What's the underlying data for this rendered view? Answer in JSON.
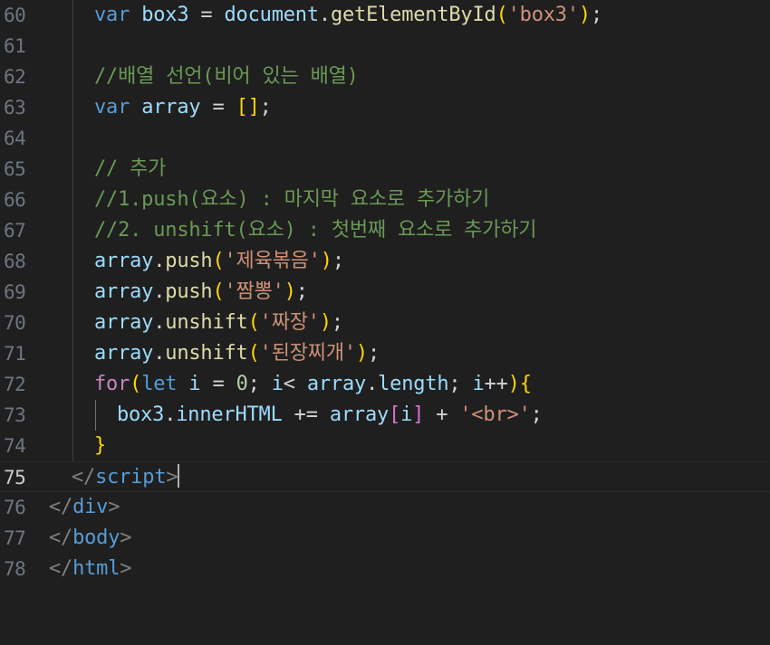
{
  "editor": {
    "current_line": "75",
    "lines": [
      {
        "number": "60",
        "indent": 2,
        "tokens": [
          {
            "t": "var",
            "c": "keyword"
          },
          {
            "t": " ",
            "c": "op"
          },
          {
            "t": "box3",
            "c": "var"
          },
          {
            "t": " = ",
            "c": "op"
          },
          {
            "t": "document",
            "c": "var"
          },
          {
            "t": ".",
            "c": "punct"
          },
          {
            "t": "getElementById",
            "c": "func"
          },
          {
            "t": "(",
            "c": "b1"
          },
          {
            "t": "'box3'",
            "c": "string"
          },
          {
            "t": ")",
            "c": "b1"
          },
          {
            "t": ";",
            "c": "punct"
          }
        ]
      },
      {
        "number": "61",
        "indent": 2,
        "tokens": []
      },
      {
        "number": "62",
        "indent": 2,
        "tokens": [
          {
            "t": "//배열 선언(비어 있는 배열)",
            "c": "comment"
          }
        ]
      },
      {
        "number": "63",
        "indent": 2,
        "tokens": [
          {
            "t": "var",
            "c": "keyword"
          },
          {
            "t": " ",
            "c": "op"
          },
          {
            "t": "array",
            "c": "var"
          },
          {
            "t": " = ",
            "c": "op"
          },
          {
            "t": "[]",
            "c": "b1"
          },
          {
            "t": ";",
            "c": "punct"
          }
        ]
      },
      {
        "number": "64",
        "indent": 2,
        "tokens": []
      },
      {
        "number": "65",
        "indent": 2,
        "tokens": [
          {
            "t": "// 추가",
            "c": "comment"
          }
        ]
      },
      {
        "number": "66",
        "indent": 2,
        "tokens": [
          {
            "t": "//1.push(요소) : 마지막 요소로 추가하기",
            "c": "comment"
          }
        ]
      },
      {
        "number": "67",
        "indent": 2,
        "tokens": [
          {
            "t": "//2. unshift(요소) : 첫번째 요소로 추가하기",
            "c": "comment"
          }
        ]
      },
      {
        "number": "68",
        "indent": 2,
        "tokens": [
          {
            "t": "array",
            "c": "var"
          },
          {
            "t": ".",
            "c": "punct"
          },
          {
            "t": "push",
            "c": "func"
          },
          {
            "t": "(",
            "c": "b1"
          },
          {
            "t": "'제육볶음'",
            "c": "string"
          },
          {
            "t": ")",
            "c": "b1"
          },
          {
            "t": ";",
            "c": "punct"
          }
        ]
      },
      {
        "number": "69",
        "indent": 2,
        "tokens": [
          {
            "t": "array",
            "c": "var"
          },
          {
            "t": ".",
            "c": "punct"
          },
          {
            "t": "push",
            "c": "func"
          },
          {
            "t": "(",
            "c": "b1"
          },
          {
            "t": "'짬뽕'",
            "c": "string"
          },
          {
            "t": ")",
            "c": "b1"
          },
          {
            "t": ";",
            "c": "punct"
          }
        ]
      },
      {
        "number": "70",
        "indent": 2,
        "tokens": [
          {
            "t": "array",
            "c": "var"
          },
          {
            "t": ".",
            "c": "punct"
          },
          {
            "t": "unshift",
            "c": "func"
          },
          {
            "t": "(",
            "c": "b1"
          },
          {
            "t": "'짜장'",
            "c": "string"
          },
          {
            "t": ")",
            "c": "b1"
          },
          {
            "t": ";",
            "c": "punct"
          }
        ]
      },
      {
        "number": "71",
        "indent": 2,
        "tokens": [
          {
            "t": "array",
            "c": "var"
          },
          {
            "t": ".",
            "c": "punct"
          },
          {
            "t": "unshift",
            "c": "func"
          },
          {
            "t": "(",
            "c": "b1"
          },
          {
            "t": "'된장찌개'",
            "c": "string"
          },
          {
            "t": ")",
            "c": "b1"
          },
          {
            "t": ";",
            "c": "punct"
          }
        ]
      },
      {
        "number": "72",
        "indent": 2,
        "tokens": [
          {
            "t": "for",
            "c": "control"
          },
          {
            "t": "(",
            "c": "b1"
          },
          {
            "t": "let",
            "c": "keyword"
          },
          {
            "t": " ",
            "c": "op"
          },
          {
            "t": "i",
            "c": "var"
          },
          {
            "t": " = ",
            "c": "op"
          },
          {
            "t": "0",
            "c": "number"
          },
          {
            "t": "; ",
            "c": "punct"
          },
          {
            "t": "i",
            "c": "var"
          },
          {
            "t": "< ",
            "c": "op"
          },
          {
            "t": "array",
            "c": "var"
          },
          {
            "t": ".",
            "c": "punct"
          },
          {
            "t": "length",
            "c": "var"
          },
          {
            "t": "; ",
            "c": "punct"
          },
          {
            "t": "i",
            "c": "var"
          },
          {
            "t": "++",
            "c": "op"
          },
          {
            "t": ")",
            "c": "b1"
          },
          {
            "t": "{",
            "c": "b1"
          }
        ]
      },
      {
        "number": "73",
        "indent": 3,
        "tokens": [
          {
            "t": "box3",
            "c": "var"
          },
          {
            "t": ".",
            "c": "punct"
          },
          {
            "t": "innerHTML",
            "c": "var"
          },
          {
            "t": " += ",
            "c": "op"
          },
          {
            "t": "array",
            "c": "var"
          },
          {
            "t": "[",
            "c": "b2"
          },
          {
            "t": "i",
            "c": "var"
          },
          {
            "t": "]",
            "c": "b2"
          },
          {
            "t": " + ",
            "c": "op"
          },
          {
            "t": "'<br>'",
            "c": "string"
          },
          {
            "t": ";",
            "c": "punct"
          }
        ]
      },
      {
        "number": "74",
        "indent": 2,
        "tokens": [
          {
            "t": "}",
            "c": "b1"
          }
        ]
      },
      {
        "number": "75",
        "indent": 1,
        "cursor": true,
        "tokens": [
          {
            "t": "</",
            "c": "angle"
          },
          {
            "t": "script",
            "c": "tag"
          },
          {
            "t": ">",
            "c": "angle"
          }
        ]
      },
      {
        "number": "76",
        "indent": 0,
        "tokens": [
          {
            "t": "</",
            "c": "angle"
          },
          {
            "t": "div",
            "c": "tag"
          },
          {
            "t": ">",
            "c": "angle"
          }
        ]
      },
      {
        "number": "77",
        "indent": 0,
        "tokens": [
          {
            "t": "</",
            "c": "angle"
          },
          {
            "t": "body",
            "c": "tag"
          },
          {
            "t": ">",
            "c": "angle"
          }
        ]
      },
      {
        "number": "78",
        "indent": 0,
        "tokens": [
          {
            "t": "</",
            "c": "angle"
          },
          {
            "t": "html",
            "c": "tag"
          },
          {
            "t": ">",
            "c": "angle"
          }
        ]
      }
    ]
  }
}
